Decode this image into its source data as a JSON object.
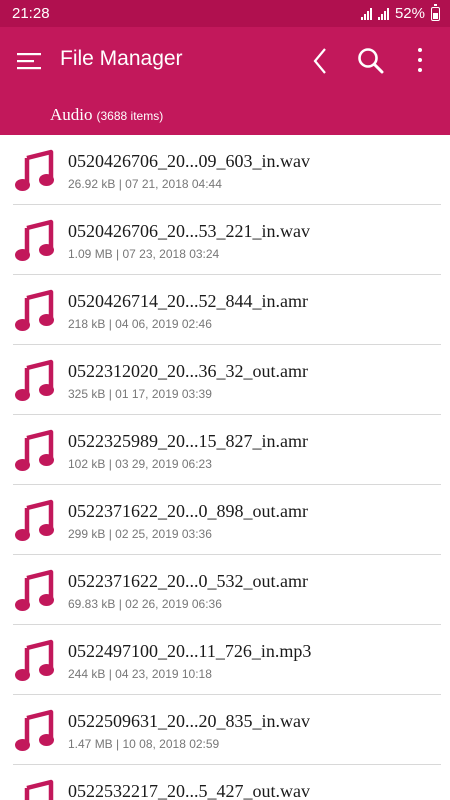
{
  "status_bar": {
    "time": "21:28",
    "battery": "52%"
  },
  "app_bar": {
    "title": "File Manager"
  },
  "folder": {
    "name": "Audio",
    "count": "(3688 items)"
  },
  "colors": {
    "primary": "#c2185b",
    "status": "#b0104f",
    "icon": "#c2185b"
  },
  "icons": {
    "file": "music-note-icon",
    "menu": "menu-icon",
    "back": "back-chevron-icon",
    "search": "search-icon",
    "more": "more-vert-icon"
  },
  "files": [
    {
      "name": "0520426706_20...09_603_in.wav",
      "meta": "26.92 kB | 07 21, 2018 04:44"
    },
    {
      "name": "0520426706_20...53_221_in.wav",
      "meta": "1.09 MB | 07 23, 2018 03:24"
    },
    {
      "name": "0520426714_20...52_844_in.amr",
      "meta": "218 kB | 04 06, 2019 02:46"
    },
    {
      "name": "0522312020_20...36_32_out.amr",
      "meta": "325 kB | 01 17, 2019 03:39"
    },
    {
      "name": "0522325989_20...15_827_in.amr",
      "meta": "102 kB | 03 29, 2019 06:23"
    },
    {
      "name": "0522371622_20...0_898_out.amr",
      "meta": "299 kB | 02 25, 2019 03:36"
    },
    {
      "name": "0522371622_20...0_532_out.amr",
      "meta": "69.83 kB | 02 26, 2019 06:36"
    },
    {
      "name": "0522497100_20...11_726_in.mp3",
      "meta": "244 kB | 04 23, 2019 10:18"
    },
    {
      "name": "0522509631_20...20_835_in.wav",
      "meta": "1.47 MB | 10 08, 2018 02:59"
    },
    {
      "name": "0522532217_20...5_427_out.wav",
      "meta": ""
    }
  ]
}
